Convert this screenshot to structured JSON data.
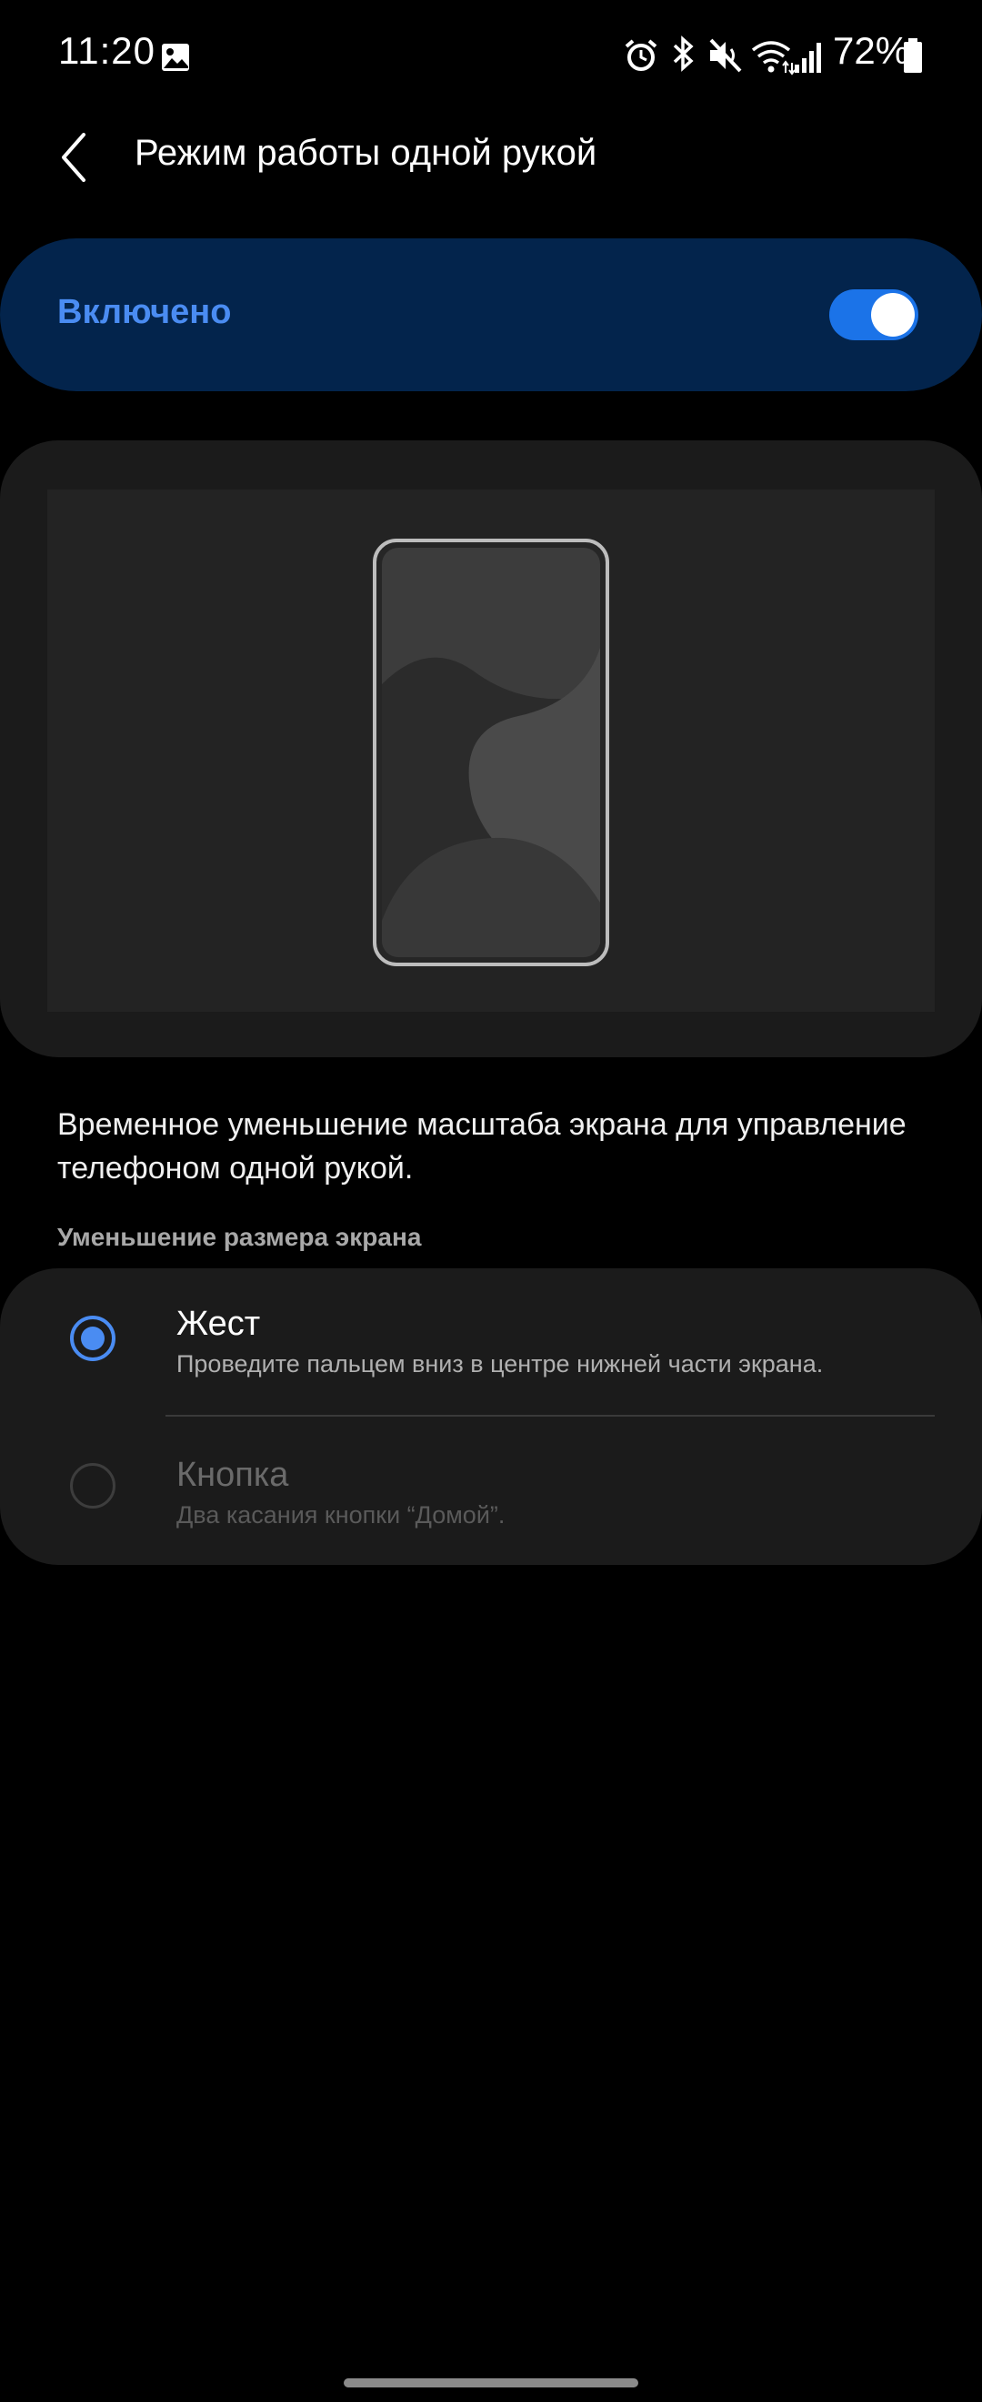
{
  "status_bar": {
    "time": "11:20",
    "battery": "72%",
    "icons": [
      "gallery-icon",
      "alarm-icon",
      "bluetooth-icon",
      "mute-icon",
      "wifi-icon",
      "signal-icon",
      "battery-icon"
    ]
  },
  "app_bar": {
    "title": "Режим работы одной рукой",
    "back_icon": "chevron-left-icon"
  },
  "toggle": {
    "label": "Включено",
    "state": "on",
    "color": "#4a8cf2",
    "card_color": "#03244c"
  },
  "description": "Временное уменьшение масштаба экрана для управление телефоном одной рукой.",
  "section": {
    "header": "Уменьшение размера экрана"
  },
  "options": [
    {
      "title": "Жест",
      "subtitle": "Проведите пальцем вниз в центре нижней части экрана.",
      "selected": true
    },
    {
      "title": "Кнопка",
      "subtitle": "Два касания кнопки “Домой”.",
      "selected": false
    }
  ],
  "colors": {
    "accent": "#4a8cf2",
    "background": "#000000",
    "card": "#1b1b1b"
  }
}
